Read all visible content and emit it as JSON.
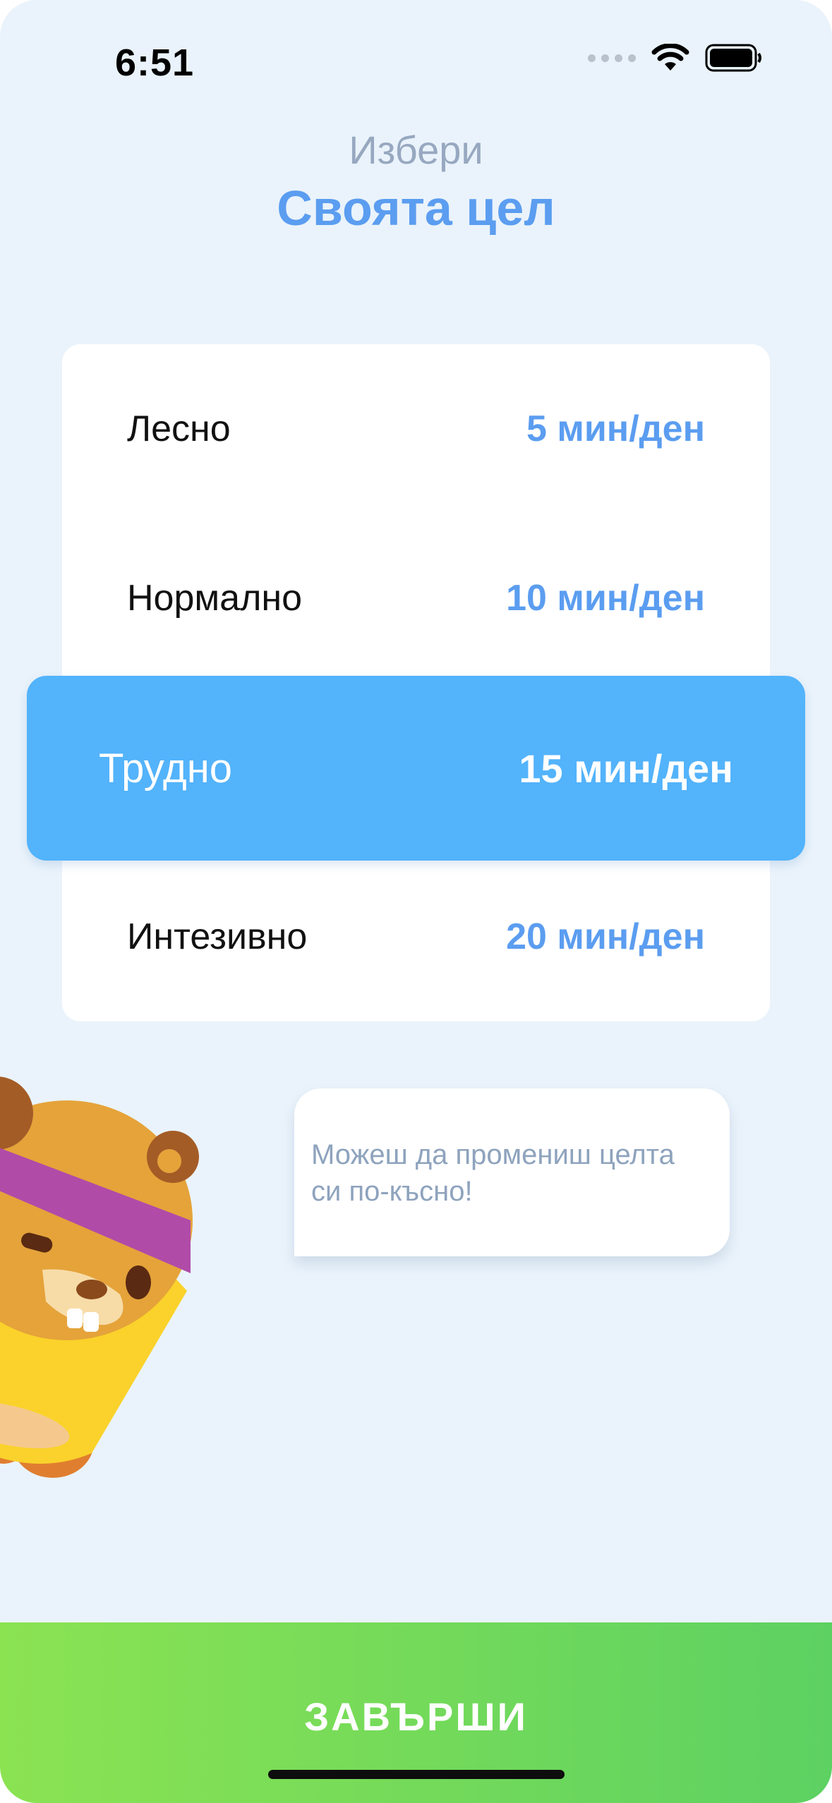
{
  "status_bar": {
    "time": "6:51"
  },
  "header": {
    "subtitle": "Избери",
    "title": "Своята цел"
  },
  "goals": [
    {
      "label": "Лесно",
      "value": "5 мин/ден"
    },
    {
      "label": "Нормално",
      "value": "10 мин/ден"
    },
    {
      "label": "Трудно",
      "value": "15 мин/ден"
    },
    {
      "label": "Интезивно",
      "value": "20 мин/ден"
    }
  ],
  "selected_goal_index": 2,
  "bubble": {
    "text": "Можеш да промениш целта си по-късно!"
  },
  "footer": {
    "finish_label": "ЗАВЪРШИ"
  },
  "colors": {
    "accent": "#5B9DF0",
    "selected": "#53B3FB",
    "button": "#6FD95B",
    "background": "#EAF3FB"
  }
}
